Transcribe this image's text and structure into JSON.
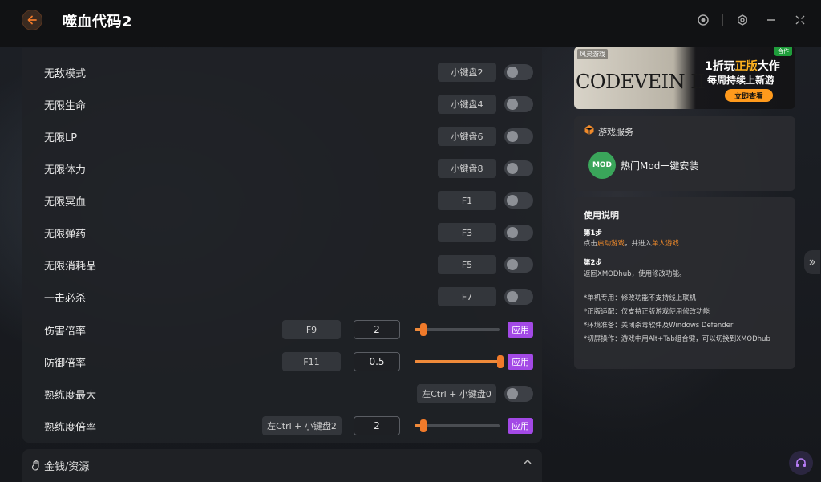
{
  "header": {
    "title": "噬血代码2"
  },
  "cheats": [
    {
      "label": "无敌模式",
      "hotkey": "小键盘2"
    },
    {
      "label": "无限生命",
      "hotkey": "小键盘4"
    },
    {
      "label": "无限LP",
      "hotkey": "小键盘6"
    },
    {
      "label": "无限体力",
      "hotkey": "小键盘8"
    },
    {
      "label": "无限冥血",
      "hotkey": "F1"
    },
    {
      "label": "无限弹药",
      "hotkey": "F3"
    },
    {
      "label": "无限消耗品",
      "hotkey": "F5"
    },
    {
      "label": "一击必杀",
      "hotkey": "F7"
    },
    {
      "label": "伤害倍率",
      "hotkey": "F9",
      "value": "2",
      "slider_fraction": 0.1,
      "apply": "应用"
    },
    {
      "label": "防御倍率",
      "hotkey": "F11",
      "value": "0.5",
      "slider_fraction": 1.0,
      "apply": "应用"
    },
    {
      "label": "熟练度最大",
      "hotkey": "左Ctrl + 小键盘0"
    },
    {
      "label": "熟练度倍率",
      "hotkey": "左Ctrl + 小键盘2",
      "value": "2",
      "slider_fraction": 0.1,
      "apply": "应用"
    }
  ],
  "section": {
    "label": "金钱/资源"
  },
  "banner": {
    "brand": "风灵游戏",
    "tag": "合作",
    "game_logo": "CODEVEIN II",
    "promo_line1_a": "1折玩",
    "promo_line1_b": "正版",
    "promo_line1_c": "大作",
    "promo_line2": "每周持续上新游",
    "cta": "立即查看"
  },
  "service": {
    "title": "游戏服务",
    "item": "热门Mod一键安装",
    "icon_text": "MOD"
  },
  "instructions": {
    "title": "使用说明",
    "step1_title": "第1步",
    "step1_a": "点击",
    "step1_link1": "启动游戏",
    "step1_b": "，并进入",
    "step1_link2": "单人游戏",
    "step2_title": "第2步",
    "step2_text": "返回XMODhub，使用修改功能。",
    "note1": "*单机专用：修改功能不支持线上联机",
    "note2": "*正版适配：仅支持正版游戏使用修改功能",
    "note3": "*环境准备：关闭杀毒软件及Windows Defender",
    "note4": "*切屏操作：游戏中用Alt+Tab组合键，可以切换到XMODhub"
  },
  "colors": {
    "accent": "#f08a3a",
    "apply": "#a349e6",
    "link": "#f08a2a"
  }
}
